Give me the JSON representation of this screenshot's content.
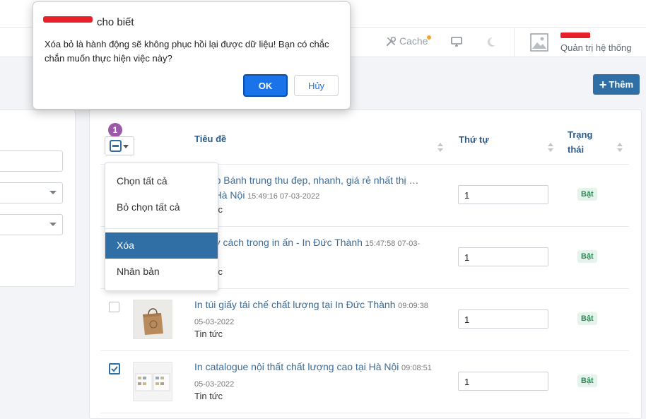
{
  "topbar": {
    "cache_label": "Cache",
    "user_role": "Quản trị hệ thống"
  },
  "actions": {
    "add_label": "Thêm"
  },
  "table": {
    "bulk_badge": "1",
    "headers": {
      "title": "Tiêu đề",
      "order": "Thứ tự",
      "status": "Trạng thái"
    },
    "rows": [
      {
        "title": "…hộp Bánh trung thu đẹp, nhanh, giá rẻ nhất thị …ờng Hà Nội",
        "time": "15:49:16 07-03-2022",
        "category": "Tin tức",
        "order": "1",
        "status": "Bật",
        "checked": false
      },
      {
        "title": "…quy cách trong in ấn - In Đức Thành",
        "time": "15:47:58 07-03-",
        "category": "Tin tức",
        "order": "1",
        "status": "Bật",
        "checked": false
      },
      {
        "title": "In túi giấy tái chế chất lượng tại In Đức Thành",
        "time": "09:09:38 05-03-2022",
        "category": "Tin tức",
        "order": "1",
        "status": "Bật",
        "checked": false
      },
      {
        "title": "In catalogue nội thất chất lượng cao tại Hà Nội",
        "time": "09:08:51 05-03-2022",
        "category": "Tin tức",
        "order": "1",
        "status": "Bật",
        "checked": true
      }
    ]
  },
  "bulk_menu": {
    "items": [
      "Chọn tất cả",
      "Bỏ chọn tất cả",
      "Xóa",
      "Nhân bản"
    ],
    "active": "Xóa"
  },
  "dialog": {
    "title_suffix": "cho biết",
    "message": "Xóa bỏ là hành động sẽ không phục hồi lại được dữ liệu! Bạn có chắc chắn muốn thực hiện việc này?",
    "ok_label": "OK",
    "cancel_label": "Hủy"
  },
  "colors": {
    "accent": "#2f6fa5",
    "link": "#3a6c99",
    "badge": "#9b59a8",
    "status_bg": "#e4f4ec",
    "status_text": "#2e8b57",
    "redaction": "#e8202a"
  }
}
